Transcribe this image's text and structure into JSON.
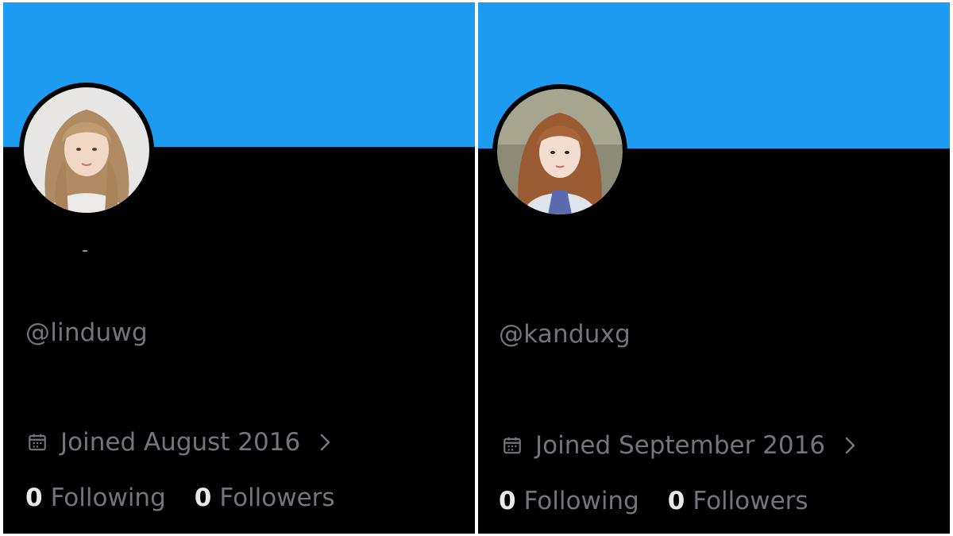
{
  "colors": {
    "banner": "#1d9bf0",
    "background": "#000000",
    "muted_text": "#71767b",
    "strong_text": "#e7e9ea"
  },
  "profiles": [
    {
      "handle": "@linduwg",
      "joined_text": "Joined August 2016",
      "joined_icon": "calendar-icon",
      "chevron_icon": "chevron-right-icon",
      "following_count": "0",
      "following_label": "Following",
      "followers_count": "0",
      "followers_label": "Followers"
    },
    {
      "handle": "@kanduxg",
      "joined_text": "Joined September 2016",
      "joined_icon": "calendar-icon",
      "chevron_icon": "chevron-right-icon",
      "following_count": "0",
      "following_label": "Following",
      "followers_count": "0",
      "followers_label": "Followers"
    }
  ]
}
